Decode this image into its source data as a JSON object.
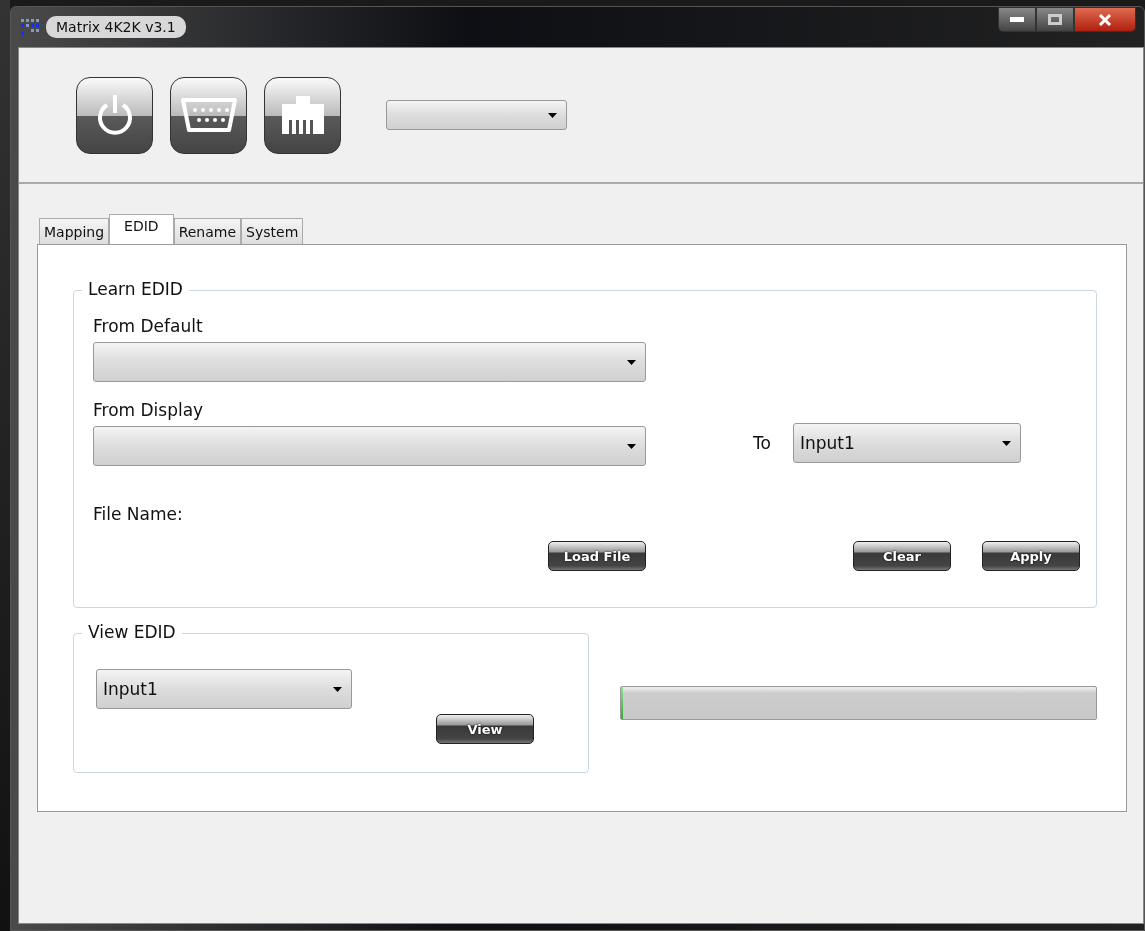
{
  "window": {
    "title": "Matrix 4K2K v3.1"
  },
  "toolbar": {
    "buttons": [
      {
        "kind": "power"
      },
      {
        "kind": "serial"
      },
      {
        "kind": "network"
      }
    ]
  },
  "tabs": [
    {
      "label": "Mapping",
      "selected": false
    },
    {
      "label": "EDID",
      "selected": true
    },
    {
      "label": "Rename",
      "selected": false
    },
    {
      "label": "System",
      "selected": false
    }
  ],
  "learn_edid": {
    "title": "Learn EDID",
    "from_default_label": "From Default",
    "from_display_label": "From Display",
    "to_label": "To",
    "to_value": "Input1",
    "file_name_label": "File Name:",
    "load_button": "Load File",
    "clear_button": "Clear",
    "apply_button": "Apply"
  },
  "view_edid": {
    "title": "View EDID",
    "input_value": "Input1",
    "view_button": "View"
  },
  "progress": {
    "level": 0
  }
}
